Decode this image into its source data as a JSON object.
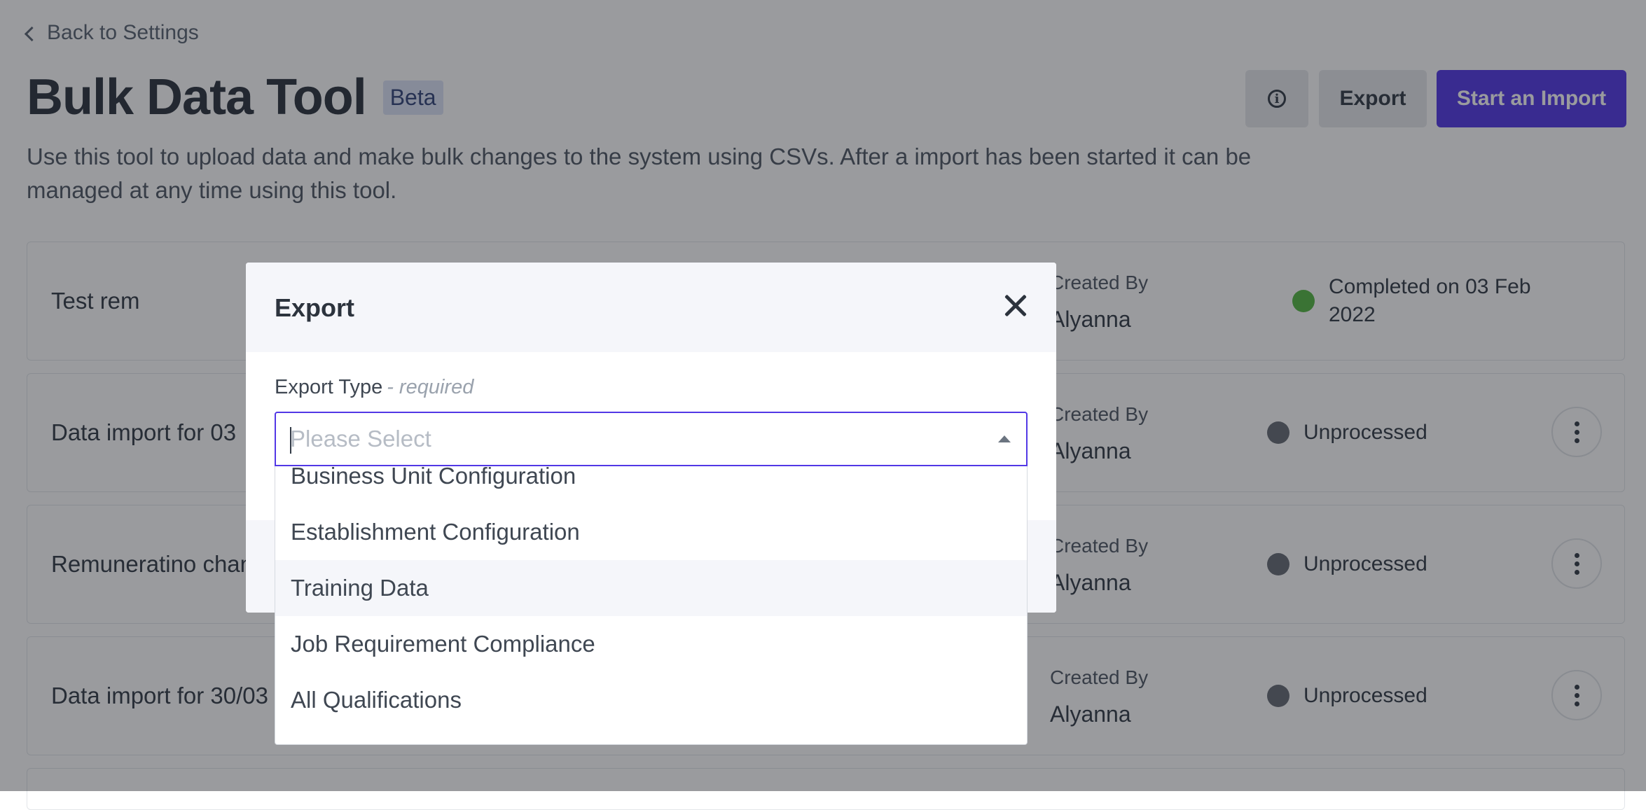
{
  "nav": {
    "back_label": "Back to Settings"
  },
  "header": {
    "title": "Bulk Data Tool",
    "badge": "Beta",
    "description": "Use this tool to upload data and make bulk changes to the system using CSVs. After a import has been started it can be managed at any time using this tool.",
    "export_label": "Export",
    "start_import_label": "Start an Import"
  },
  "imports": {
    "created_by_label": "Created By",
    "rows": [
      {
        "name": "Test rem",
        "user": "Alyanna",
        "status": "Completed on 03 Feb 2022",
        "status_color": "#55b842"
      },
      {
        "name": "Data import for 03",
        "user": "Alyanna",
        "status": "Unprocessed",
        "status_color": "#666c75"
      },
      {
        "name": "Remuneratino change",
        "user": "Alyanna",
        "status": "Unprocessed",
        "status_color": "#666c75"
      },
      {
        "name": "Data import for 30/03",
        "user": "Alyanna",
        "status": "Unprocessed",
        "status_color": "#666c75"
      }
    ]
  },
  "modal": {
    "title": "Export",
    "field_label": "Export Type",
    "field_required": "- required",
    "placeholder": "Please Select",
    "options": [
      "Business Unit Configuration",
      "Establishment Configuration",
      "Training Data",
      "Job Requirement Compliance",
      "All Qualifications"
    ],
    "highlighted_option": "Training Data"
  },
  "colors": {
    "accent": "#5238e6",
    "completed": "#55b842",
    "unprocessed": "#666c75"
  }
}
